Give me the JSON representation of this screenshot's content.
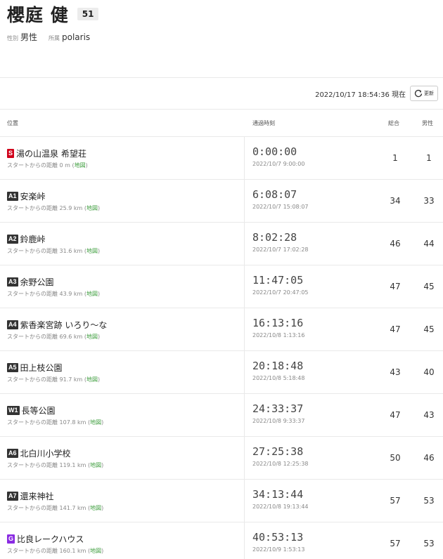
{
  "runner": {
    "name": "櫻庭 健",
    "bib": "51",
    "gender_label": "性別",
    "gender_value": "男性",
    "affiliation_label": "所属",
    "affiliation_value": "polaris"
  },
  "update": {
    "timestamp": "2022/10/17 18:54:36",
    "current_label": "現在",
    "refresh_label": "更新",
    "refresh_icon": "refresh-icon"
  },
  "table": {
    "headers": {
      "location": "位置",
      "passage_time": "通過時刻",
      "overall": "総合",
      "gender": "男性"
    },
    "distance_prefix": "スタートからの距離",
    "map_label": "地図",
    "rows": [
      {
        "badge": "S",
        "badge_color": "#d0021b",
        "location": "湯の山温泉 希望荘",
        "distance": "0 m",
        "elapsed": "0:00:00",
        "clock": "2022/10/7 9:00:00",
        "overall": "1",
        "gender": "1"
      },
      {
        "badge": "A1",
        "badge_color": "#333333",
        "location": "安楽峠",
        "distance": "25.9 km",
        "elapsed": "6:08:07",
        "clock": "2022/10/7 15:08:07",
        "overall": "34",
        "gender": "33"
      },
      {
        "badge": "A2",
        "badge_color": "#333333",
        "location": "鈴鹿峠",
        "distance": "31.6 km",
        "elapsed": "8:02:28",
        "clock": "2022/10/7 17:02:28",
        "overall": "46",
        "gender": "44"
      },
      {
        "badge": "A3",
        "badge_color": "#333333",
        "location": "余野公園",
        "distance": "43.9 km",
        "elapsed": "11:47:05",
        "clock": "2022/10/7 20:47:05",
        "overall": "47",
        "gender": "45"
      },
      {
        "badge": "A4",
        "badge_color": "#333333",
        "location": "紫香楽宮跡 いろり〜な",
        "distance": "69.6 km",
        "elapsed": "16:13:16",
        "clock": "2022/10/8 1:13:16",
        "overall": "47",
        "gender": "45"
      },
      {
        "badge": "A5",
        "badge_color": "#333333",
        "location": "田上枝公園",
        "distance": "91.7 km",
        "elapsed": "20:18:48",
        "clock": "2022/10/8 5:18:48",
        "overall": "43",
        "gender": "40"
      },
      {
        "badge": "W1",
        "badge_color": "#333333",
        "location": "長等公園",
        "distance": "107.8 km",
        "elapsed": "24:33:37",
        "clock": "2022/10/8 9:33:37",
        "overall": "47",
        "gender": "43"
      },
      {
        "badge": "A6",
        "badge_color": "#333333",
        "location": "北白川小学校",
        "distance": "119.1 km",
        "elapsed": "27:25:38",
        "clock": "2022/10/8 12:25:38",
        "overall": "50",
        "gender": "46"
      },
      {
        "badge": "A7",
        "badge_color": "#333333",
        "location": "還来神社",
        "distance": "141.7 km",
        "elapsed": "34:13:44",
        "clock": "2022/10/8 19:13:44",
        "overall": "57",
        "gender": "53"
      },
      {
        "badge": "G",
        "badge_color": "#8a2be2",
        "location": "比良レークハウス",
        "distance": "160.1 km",
        "elapsed": "40:53:13",
        "clock": "2022/10/9 1:53:13",
        "overall": "57",
        "gender": "53"
      }
    ]
  }
}
